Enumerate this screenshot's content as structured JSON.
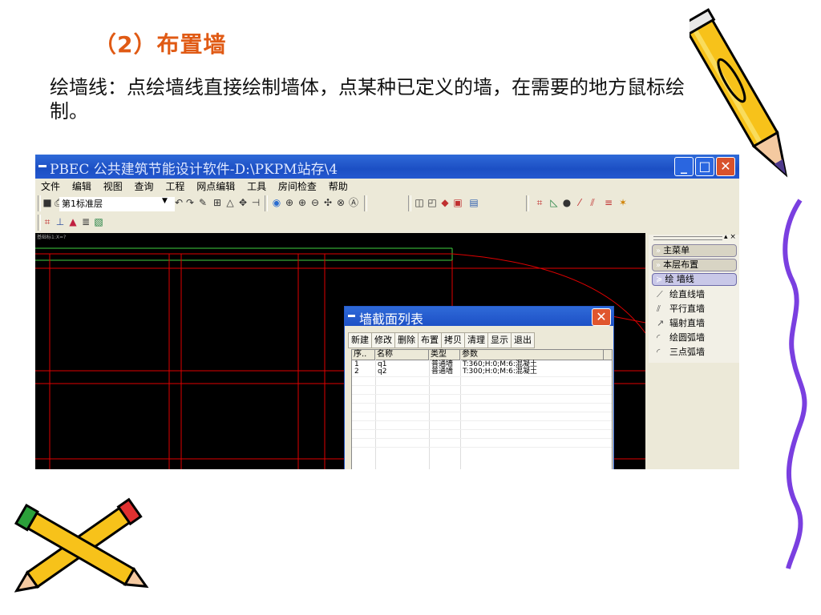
{
  "slide": {
    "title": "（2）布置墙",
    "body": "绘墙线：点绘墙线直接绘制墙体，点某种已定义的墙，在需要的地方鼠标绘制。"
  },
  "window": {
    "title": "PBEC 公共建筑节能设计软件-D:\\PKPM站存\\4",
    "menu": [
      "文件",
      "编辑",
      "视图",
      "查询",
      "工程",
      "网点编辑",
      "工具",
      "房间检查",
      "帮助"
    ],
    "floor_select": "第1标准层",
    "canvas_label": "基础标1:X=?"
  },
  "side_panel": {
    "buttons": [
      "主菜单",
      "本层布置",
      "绘  墙线"
    ],
    "items": [
      {
        "label": "绘直线墙",
        "icon": "polyline-icon"
      },
      {
        "label": "平行直墙",
        "icon": "parallel-lines-icon"
      },
      {
        "label": "辐射直墙",
        "icon": "radial-line-icon"
      },
      {
        "label": "绘圆弧墙",
        "icon": "arc-icon"
      },
      {
        "label": "三点弧墙",
        "icon": "three-point-arc-icon"
      }
    ]
  },
  "dialog": {
    "title": "墙截面列表",
    "buttons": [
      "新建",
      "修改",
      "删除",
      "布置",
      "拷贝",
      "清理",
      "显示",
      "退出"
    ],
    "columns": [
      "序..",
      "名称",
      "类型",
      "参数"
    ],
    "rows": [
      {
        "no": "1",
        "name": "q1",
        "type": "普通墙",
        "params": "T:360;H:0;M:6:混凝土"
      },
      {
        "no": "2",
        "name": "q2",
        "type": "普通墙",
        "params": "T:300;H:0;M:6:混凝土"
      }
    ]
  },
  "colors": {
    "title_orange": "#e05a14",
    "xp_blue": "#2458cf",
    "grid_red": "#e00000",
    "wall_green": "#40d040"
  }
}
